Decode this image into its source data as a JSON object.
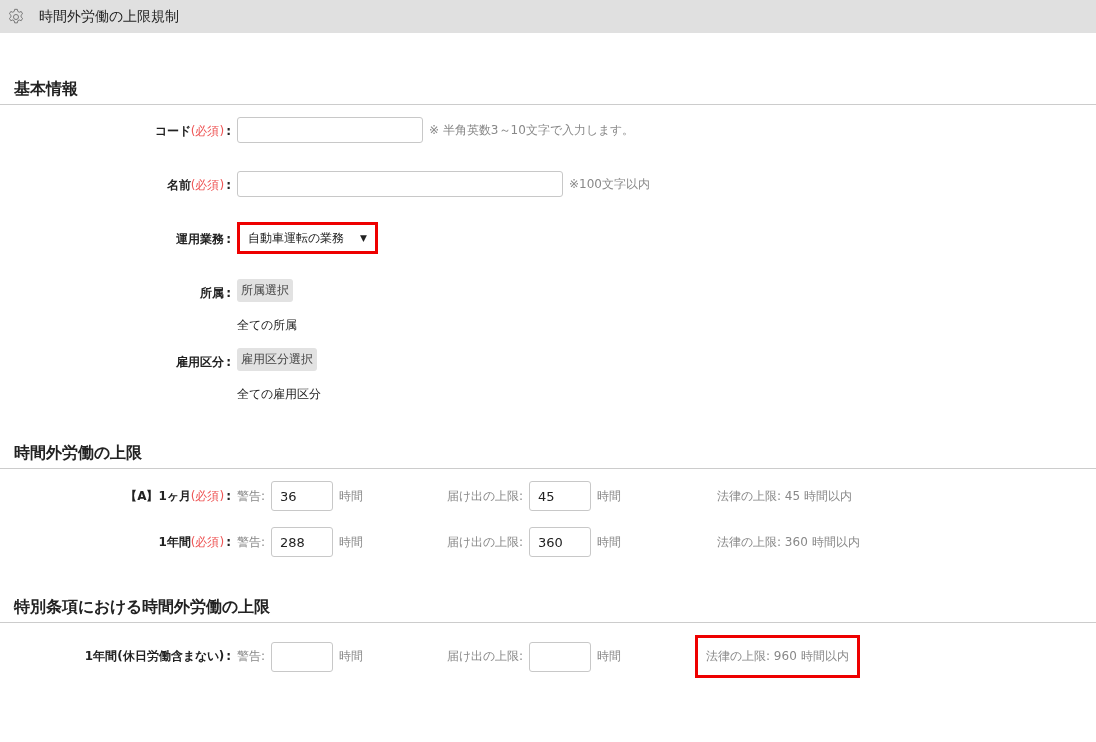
{
  "header": {
    "title": "時間外労働の上限規制"
  },
  "basic": {
    "title": "基本情報",
    "rows": [
      {
        "kind": "text",
        "label": "コード",
        "required": "(必須)",
        "colon": ":",
        "hint": "※ 半角英数3～10文字で入力します。"
      },
      {
        "kind": "text",
        "label": "名前",
        "required": "(必須)",
        "colon": ":",
        "hint": "※100文字以内"
      },
      {
        "kind": "select",
        "label": "運用業務",
        "colon": ":",
        "value": "自動車運転の業務",
        "caret": "▼",
        "highlighted": true
      },
      {
        "kind": "picker",
        "label": "所属",
        "colon": ":",
        "button": "所属選択",
        "note": "全ての所属"
      },
      {
        "kind": "picker",
        "label": "雇用区分",
        "colon": ":",
        "button": "雇用区分選択",
        "note": "全ての雇用区分"
      }
    ]
  },
  "limits": [
    {
      "title": "時間外労働の上限",
      "rows": [
        {
          "label": "【A】1ヶ月",
          "required": "(必須)",
          "colon": ":",
          "warn_label": "警告:",
          "warn_value": "36",
          "warn_unit": "時間",
          "filing_label": "届け出の上限:",
          "filing_value": "45",
          "filing_unit": "時間",
          "legal": "法律の上限: 45 時間以内",
          "highlighted": false
        },
        {
          "label": "1年間",
          "required": "(必須)",
          "colon": ":",
          "warn_label": "警告:",
          "warn_value": "288",
          "warn_unit": "時間",
          "filing_label": "届け出の上限:",
          "filing_value": "360",
          "filing_unit": "時間",
          "legal": "法律の上限: 360 時間以内",
          "highlighted": false
        }
      ]
    },
    {
      "title": "特別条項における時間外労働の上限",
      "rows": [
        {
          "label": "1年間(休日労働含まない)",
          "colon": ":",
          "warn_label": "警告:",
          "warn_unit": "時間",
          "filing_label": "届け出の上限:",
          "filing_unit": "時間",
          "legal": "法律の上限: 960 時間以内",
          "highlighted": true
        }
      ]
    }
  ]
}
